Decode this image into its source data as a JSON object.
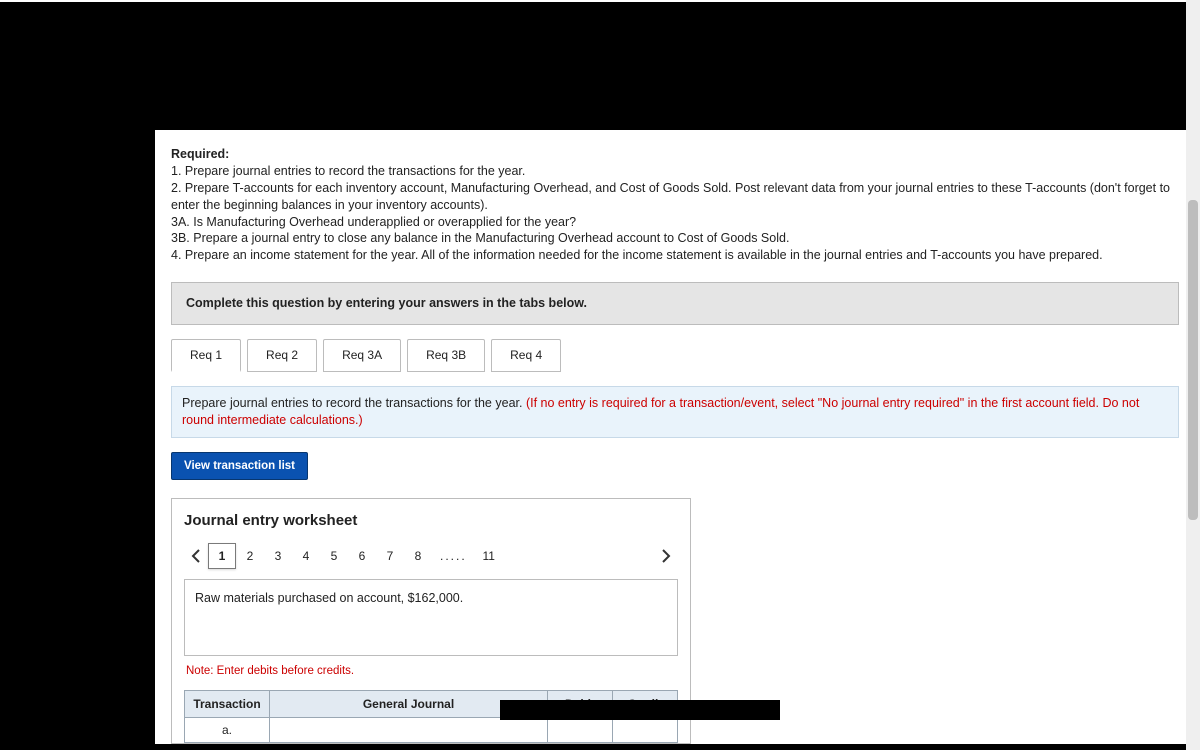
{
  "required": {
    "heading": "Required:",
    "lines": [
      "1. Prepare journal entries to record the transactions for the year.",
      "2. Prepare T-accounts for each inventory account, Manufacturing Overhead, and Cost of Goods Sold. Post relevant data from your journal entries to these T-accounts (don't forget to enter the beginning balances in your inventory accounts).",
      "3A. Is Manufacturing Overhead underapplied or overapplied for the year?",
      "3B. Prepare a journal entry to close any balance in the Manufacturing Overhead account to Cost of Goods Sold.",
      "4. Prepare an income statement for the year. All of the information needed for the income statement is available in the journal entries and T-accounts you have prepared."
    ]
  },
  "banner": "Complete this question by entering your answers in the tabs below.",
  "tabs": [
    "Req 1",
    "Req 2",
    "Req 3A",
    "Req 3B",
    "Req 4"
  ],
  "prompt": {
    "black": "Prepare journal entries to record the transactions for the year. ",
    "red": "(If no entry is required for a transaction/event, select \"No journal entry required\" in the first account field. Do not round intermediate calculations.)"
  },
  "view_btn": "View transaction list",
  "worksheet": {
    "title": "Journal entry worksheet",
    "steps": [
      "1",
      "2",
      "3",
      "4",
      "5",
      "6",
      "7",
      "8"
    ],
    "ellipsis": ".....",
    "last_step": "11",
    "active_step": "1",
    "description": "Raw materials purchased on account, $162,000.",
    "note": "Note: Enter debits before credits.",
    "headers": {
      "txn": "Transaction",
      "gj": "General Journal",
      "debit": "Debit",
      "credit": "Credit"
    },
    "row1_txn": "a."
  }
}
